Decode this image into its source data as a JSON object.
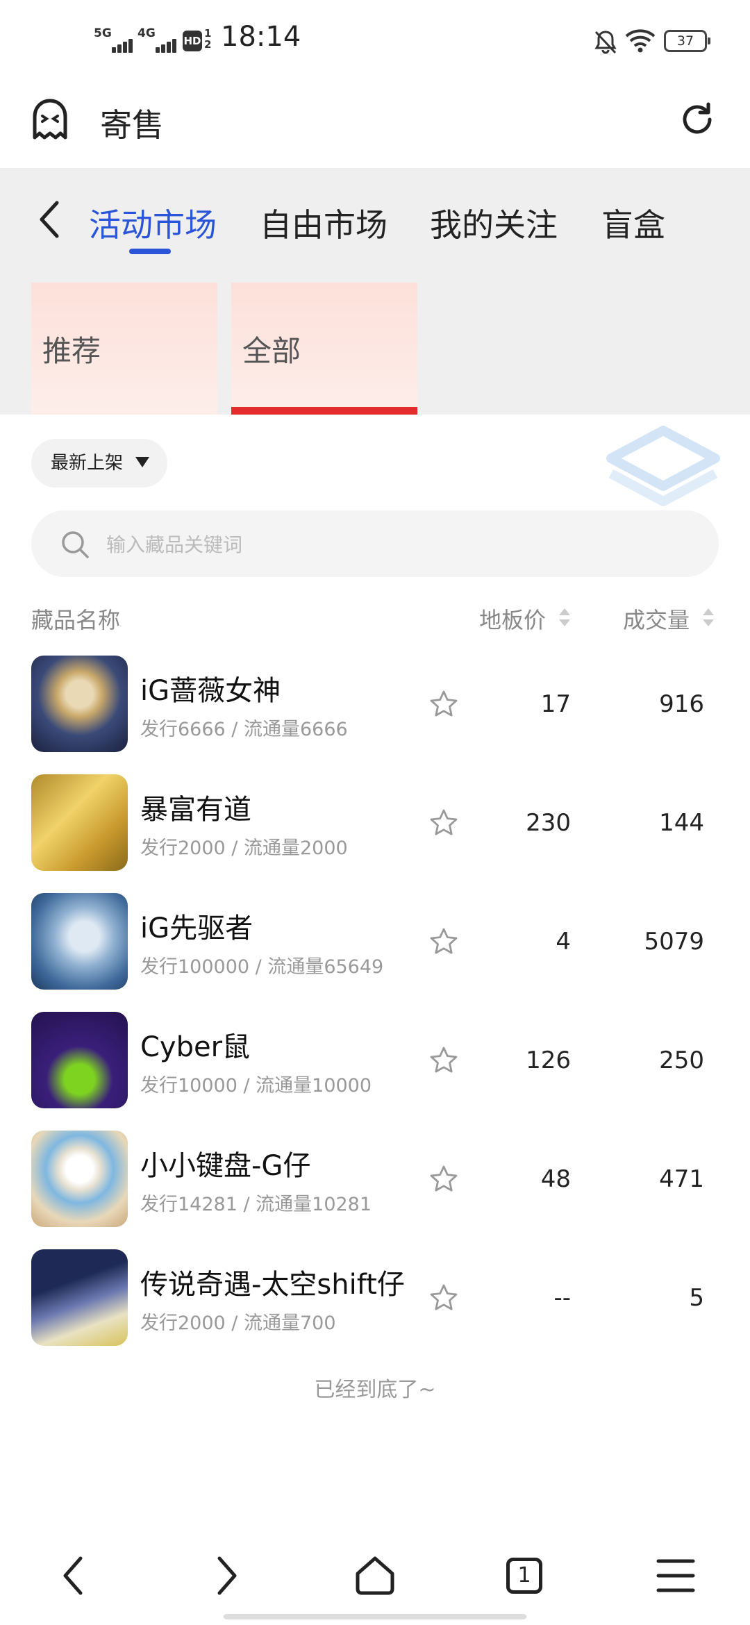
{
  "status_bar": {
    "signal1_label": "5G",
    "signal2_label": "4G",
    "hd_label": "HD",
    "hd_sub": "1 2",
    "time": "18:14",
    "battery": "37",
    "icons": [
      "bell-off-icon",
      "wifi-icon",
      "battery-icon"
    ]
  },
  "header": {
    "logo_icon": "ghost-icon",
    "title": "寄售",
    "refresh_icon": "refresh-icon"
  },
  "tabs": {
    "back_icon": "chevron-left-icon",
    "items": [
      "活动市场",
      "自由市场",
      "我的关注",
      "盲盒"
    ],
    "active_index": 0,
    "active_color": "#2b55d9"
  },
  "subtabs": {
    "items": [
      "推荐",
      "全部"
    ],
    "active_index": 1,
    "underline_color": "#e52c2c"
  },
  "sort": {
    "label": "最新上架"
  },
  "search": {
    "placeholder": "输入藏品关键词"
  },
  "table": {
    "col_name": "藏品名称",
    "col_price": "地板价",
    "col_volume": "成交量",
    "rows": [
      {
        "name": "iG蔷薇女神",
        "sub": "发行6666 / 流通量6666",
        "price": "17",
        "volume": "916"
      },
      {
        "name": "暴富有道",
        "sub": "发行2000 / 流通量2000",
        "price": "230",
        "volume": "144"
      },
      {
        "name": "iG先驱者",
        "sub": "发行100000 / 流通量65649",
        "price": "4",
        "volume": "5079"
      },
      {
        "name": "Cyber鼠",
        "sub": "发行10000 / 流通量10000",
        "price": "126",
        "volume": "250"
      },
      {
        "name": "小小键盘-G仔",
        "sub": "发行14281 / 流通量10281",
        "price": "48",
        "volume": "471"
      },
      {
        "name": "传说奇遇-太空shift仔",
        "sub": "发行2000 / 流通量700",
        "price": "--",
        "volume": "5"
      }
    ],
    "end_message": "已经到底了~"
  },
  "bottom_nav": {
    "tab_count": "1",
    "icons": [
      "back-icon",
      "forward-icon",
      "home-icon",
      "tabs-icon",
      "menu-icon"
    ]
  }
}
